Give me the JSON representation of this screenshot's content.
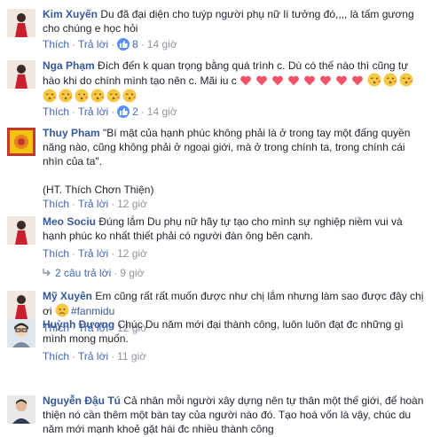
{
  "comments": [
    {
      "author": "Kim Xuyến",
      "text": "Du đã đại diện cho tuýp người phụ nữ lí tưởng đó,,,, là tấm gương cho chúng e học hỏi",
      "like": "Thích",
      "reply": "Trả lời",
      "likes": "8",
      "time": "14 giờ"
    },
    {
      "author": "Nga Phạm",
      "text": "Đích đến k quan trọng bằng quá trình c. Dù có thế nào thì cũng tự hào khi do chính mình tạo nên c. Mãi iu c",
      "like": "Thích",
      "reply": "Trả lời",
      "likes": "2",
      "time": "14 giờ"
    },
    {
      "author": "Thuy Pham",
      "text": "\"Bí mật của hạnh phúc không phải là ở trong tay một đấng quyền năng nào, cũng không phải ở ngoại giới, mà ở trong chính ta, trong chính cái nhìn của ta\".",
      "quote": "(HT. Thích Chơn Thiện)",
      "like": "Thích",
      "reply": "Trả lời",
      "time": "12 giờ"
    },
    {
      "author": "Meo Sociu",
      "text": "Đúng lắm Du phụ nữ hãy tự tạo cho mình sự nghiệp niềm vui và hạnh phúc ko nhất thiết phải có người đàn ông bên cạnh.",
      "like": "Thích",
      "reply": "Trả lời",
      "time": "12 giờ",
      "replies_label": "2 câu trả lời",
      "replies_time": "9 giờ"
    },
    {
      "author": "Mỹ Xuyên",
      "text": "Em cũng rất rất muốn được như chị lắm nhưng làm sao được đây chị ơi",
      "hashtag": "#fanmidu",
      "like": "Thích",
      "reply": "Trả lời",
      "time": "12 giờ"
    },
    {
      "author": "Huỳnh Dương",
      "text": "Chúc Du năm mới đại thành công, luôn luôn đạt đc những gì mình mong muốn.",
      "like": "Thích",
      "reply": "Trả lời",
      "time": "11 giờ"
    },
    {
      "author": "Nguyễn Đậu Tú",
      "text": "Cả nhân mỗi người xây dựng nên tự thân một thế giới, để hoàn thiện nó cần thêm một bàn tay của người nào đó. Tạo hoá vốn là vậy, chúc du năm mới mạnh khoẻ gặt hái đc nhiều thành công"
    }
  ],
  "sep": "·",
  "colors": {
    "name": "#365899",
    "link": "#4267b2",
    "meta": "#90949c",
    "like_badge": "#5890ff",
    "heart": "#f25268"
  },
  "icons": [
    "avatar",
    "like-icon",
    "heart-emoji",
    "kiss-emoji",
    "sad-emoji",
    "reply-arrow-icon"
  ]
}
